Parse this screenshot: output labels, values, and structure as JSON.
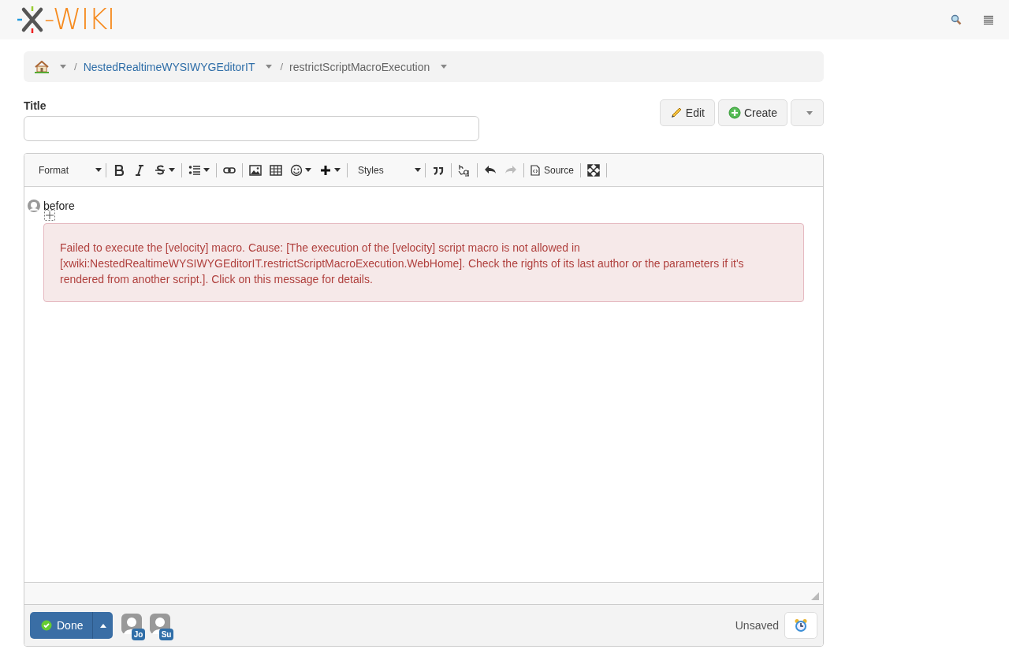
{
  "header": {
    "logo_text": "-WIKI"
  },
  "breadcrumb": [
    {
      "kind": "home"
    },
    {
      "kind": "link",
      "separator": "/",
      "label": "NestedRealtimeWYSIWYGEditorIT"
    },
    {
      "kind": "current",
      "separator": "/",
      "label": "restrictScriptMacroExecution"
    }
  ],
  "title_field": {
    "label": "Title"
  },
  "actions": [
    {
      "kind": "edit",
      "label": "Edit"
    },
    {
      "kind": "create",
      "label": "Create"
    },
    {
      "kind": "more"
    }
  ],
  "toolbar": [
    {
      "kind": "dropdown",
      "label": "Format"
    },
    {
      "kind": "sep"
    },
    {
      "kind": "bold"
    },
    {
      "kind": "italic"
    },
    {
      "kind": "strike"
    },
    {
      "kind": "sep"
    },
    {
      "kind": "list"
    },
    {
      "kind": "sep"
    },
    {
      "kind": "link"
    },
    {
      "kind": "sep"
    },
    {
      "kind": "image"
    },
    {
      "kind": "table"
    },
    {
      "kind": "smiley"
    },
    {
      "kind": "plus"
    },
    {
      "kind": "sep"
    },
    {
      "kind": "dropdown",
      "label": "Styles"
    },
    {
      "kind": "sep"
    },
    {
      "kind": "quote"
    },
    {
      "kind": "sep"
    },
    {
      "kind": "replace"
    },
    {
      "kind": "sep"
    },
    {
      "kind": "undo",
      "disabled": false
    },
    {
      "kind": "redo",
      "disabled": true
    },
    {
      "kind": "sep"
    },
    {
      "kind": "source",
      "label": "Source"
    },
    {
      "kind": "sep"
    },
    {
      "kind": "maximize"
    },
    {
      "kind": "sep"
    }
  ],
  "content": {
    "paragraph": "before",
    "error": "Failed to execute the [velocity] macro. Cause: [The execution of the [velocity] script macro is not allowed in [xwiki:NestedRealtimeWYSIWYGEditorIT.restrictScriptMacroExecution.WebHome]. Check the rights of its last author or the parameters if it's rendered from another script.]. Click on this message for details."
  },
  "footer": {
    "done": "Done",
    "users": [
      "Jo",
      "Su"
    ],
    "status": "Unsaved"
  }
}
